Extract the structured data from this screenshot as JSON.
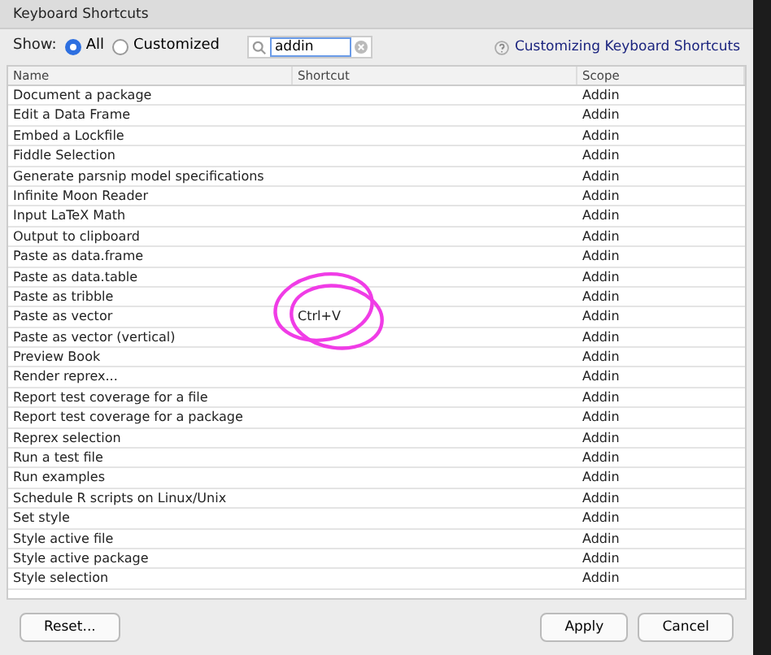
{
  "window": {
    "title": "Keyboard Shortcuts"
  },
  "filter": {
    "label": "Show:",
    "options": [
      {
        "label": "All",
        "selected": true
      },
      {
        "label": "Customized",
        "selected": false
      }
    ]
  },
  "search": {
    "value": "addin"
  },
  "help_link": "Customizing Keyboard Shortcuts",
  "table": {
    "columns": [
      "Name",
      "Shortcut",
      "Scope"
    ],
    "rows": [
      {
        "name": "Document a package",
        "shortcut": "",
        "scope": "Addin"
      },
      {
        "name": "Edit a Data Frame",
        "shortcut": "",
        "scope": "Addin"
      },
      {
        "name": "Embed a Lockfile",
        "shortcut": "",
        "scope": "Addin"
      },
      {
        "name": "Fiddle Selection",
        "shortcut": "",
        "scope": "Addin"
      },
      {
        "name": "Generate parsnip model specifications",
        "shortcut": "",
        "scope": "Addin"
      },
      {
        "name": "Infinite Moon Reader",
        "shortcut": "",
        "scope": "Addin"
      },
      {
        "name": "Input LaTeX Math",
        "shortcut": "",
        "scope": "Addin"
      },
      {
        "name": "Output to clipboard",
        "shortcut": "",
        "scope": "Addin"
      },
      {
        "name": "Paste as data.frame",
        "shortcut": "",
        "scope": "Addin"
      },
      {
        "name": "Paste as data.table",
        "shortcut": "",
        "scope": "Addin"
      },
      {
        "name": "Paste as tribble",
        "shortcut": "",
        "scope": "Addin"
      },
      {
        "name": "Paste as vector",
        "shortcut": "Ctrl+V",
        "scope": "Addin"
      },
      {
        "name": "Paste as vector (vertical)",
        "shortcut": "",
        "scope": "Addin"
      },
      {
        "name": "Preview Book",
        "shortcut": "",
        "scope": "Addin"
      },
      {
        "name": "Render reprex...",
        "shortcut": "",
        "scope": "Addin"
      },
      {
        "name": "Report test coverage for a file",
        "shortcut": "",
        "scope": "Addin"
      },
      {
        "name": "Report test coverage for a package",
        "shortcut": "",
        "scope": "Addin"
      },
      {
        "name": "Reprex selection",
        "shortcut": "",
        "scope": "Addin"
      },
      {
        "name": "Run a test file",
        "shortcut": "",
        "scope": "Addin"
      },
      {
        "name": "Run examples",
        "shortcut": "",
        "scope": "Addin"
      },
      {
        "name": "Schedule R scripts on Linux/Unix",
        "shortcut": "",
        "scope": "Addin"
      },
      {
        "name": "Set style",
        "shortcut": "",
        "scope": "Addin"
      },
      {
        "name": "Style active file",
        "shortcut": "",
        "scope": "Addin"
      },
      {
        "name": "Style active package",
        "shortcut": "",
        "scope": "Addin"
      },
      {
        "name": "Style selection",
        "shortcut": "",
        "scope": "Addin"
      }
    ]
  },
  "buttons": {
    "left": [
      "Reset..."
    ],
    "right": [
      "Apply",
      "Cancel"
    ]
  }
}
